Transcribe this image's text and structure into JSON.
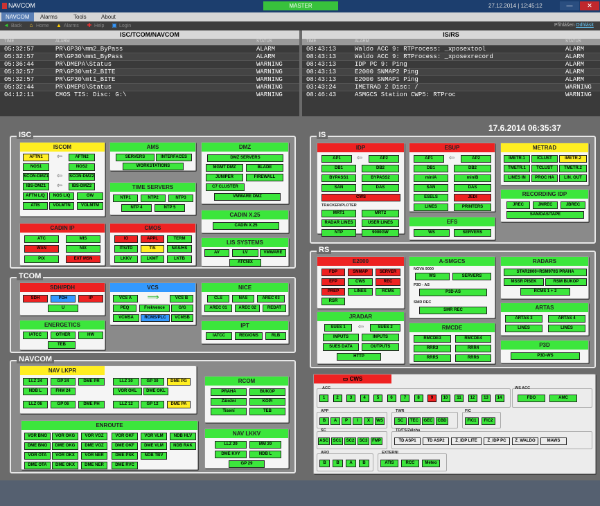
{
  "window": {
    "app_title": "NAVCOM",
    "master": "MASTER",
    "clock": "27.12.2014 | 12:45:12",
    "min_label": "—",
    "close_label": "✕"
  },
  "menu": [
    "NAVCOM",
    "Alarms",
    "Tools",
    "About"
  ],
  "toolbar": {
    "back": "Back",
    "home": "Home",
    "alarms": "Alarms",
    "help": "Help",
    "login": "Login",
    "user": "Přihlášen",
    "logout": "Odhlásit"
  },
  "alarm_left": {
    "title": "ISC/TCOM/NAVCOM",
    "col_time": "TIME",
    "col_alarm": "ALARM",
    "col_status": "STATUS",
    "rows": [
      {
        "time": "05:32:57",
        "alarm": "PR\\GP30\\mm2_ByPass",
        "status": "ALARM"
      },
      {
        "time": "05:32:57",
        "alarm": "PR\\GP30\\mm1_ByPass",
        "status": "ALARM"
      },
      {
        "time": "05:36:44",
        "alarm": "PR\\DMEPA\\Status",
        "status": "WARNING"
      },
      {
        "time": "05:32:57",
        "alarm": "PR\\GP30\\mt2_BITE",
        "status": "WARNING"
      },
      {
        "time": "05:32:57",
        "alarm": "PR\\GP30\\mt1_BITE",
        "status": "WARNING"
      },
      {
        "time": "05:32:44",
        "alarm": "PR\\DMEPG\\Status",
        "status": "WARNING"
      },
      {
        "time": "04:12:11",
        "alarm": "CMOS TIS: Disc: G:\\",
        "status": "WARNING"
      }
    ]
  },
  "alarm_right": {
    "title": "IS/RS",
    "col_time": "TIME",
    "col_alarm": "ALARM",
    "col_status": "STATUS",
    "rows": [
      {
        "time": "08:43:13",
        "alarm": "Waldo ACC 9: RTProcess: _xposextool",
        "status": "ALARM"
      },
      {
        "time": "08:43:13",
        "alarm": "Waldo ACC 9: RTProcess: _xposexrecord",
        "status": "ALARM"
      },
      {
        "time": "08:43:13",
        "alarm": "IDP PC 9: Ping",
        "status": "ALARM"
      },
      {
        "time": "08:43:13",
        "alarm": "E2000 SNMAP2 Ping",
        "status": "ALARM"
      },
      {
        "time": "08:43:13",
        "alarm": "E2000 SNMAP1 Ping",
        "status": "ALARM"
      },
      {
        "time": "03:43:24",
        "alarm": "IMETRAD 2 Disc: /",
        "status": "WARNING"
      },
      {
        "time": "08:46:43",
        "alarm": "ASMGCS Station CWP5: RTProc",
        "status": "WARNING"
      }
    ]
  },
  "timestamp": "17.6.2014 06:35:37",
  "colors": {
    "green": "#3ce63c",
    "red": "#ee2222",
    "yellow": "#ffee22",
    "blue": "#3399ff"
  },
  "groups": {
    "isc": "ISC",
    "tcom": "TCOM",
    "navcom": "NAVCOM",
    "is": "IS",
    "rs": "RS"
  },
  "panels": [
    {
      "id": "iscom",
      "title": "ISCOM",
      "color": "y",
      "buttons": [
        [
          "AFTN1",
          "y"
        ],
        [
          "AFTN2",
          "g"
        ],
        [
          "NOS1",
          "g"
        ],
        [
          "NOS2",
          "g"
        ],
        [
          "SCON-DMZ1",
          "g"
        ],
        [
          "SCON-DMZ2",
          "g"
        ],
        [
          "IBS-DMZ1",
          "g"
        ],
        [
          "IBS-DMZ2",
          "g"
        ],
        [
          "AFTN L/Q",
          "g"
        ],
        [
          "NOS L/Q",
          "g"
        ],
        [
          "GW",
          "g"
        ],
        [
          "ATIS",
          "g"
        ],
        [
          "VOLMTN",
          "g"
        ],
        [
          "VOLMTM",
          "g"
        ]
      ]
    },
    {
      "id": "ams",
      "title": "AMS",
      "color": "g",
      "buttons": [
        [
          "SERVERS",
          "g"
        ],
        [
          "INTERFACES",
          "g"
        ],
        [
          "WORKSTATIONS",
          "g"
        ]
      ]
    },
    {
      "id": "timeservers",
      "title": "TIME SERVERS",
      "color": "g",
      "buttons": [
        [
          "NTP1",
          "g"
        ],
        [
          "NTP2",
          "g"
        ],
        [
          "NTP3",
          "g"
        ],
        [
          "NTP 4",
          "g"
        ],
        [
          "NTP 5",
          "g"
        ]
      ]
    },
    {
      "id": "dmz",
      "title": "DMZ",
      "color": "g",
      "buttons": [
        [
          "DMZ SERVERS",
          "g"
        ],
        [
          "MGMT DMZ",
          "g"
        ],
        [
          "BLADE",
          "g"
        ],
        [
          "JUNIPER",
          "g"
        ],
        [
          "FIREWALL",
          "g"
        ],
        [
          "C7 CLUSTER",
          "g"
        ],
        [
          "VMWARE DMZ",
          "g"
        ]
      ]
    },
    {
      "id": "cadinx25",
      "title": "CADIN X.25",
      "color": "g",
      "buttons": [
        [
          "CADIN X.25",
          "g"
        ]
      ]
    },
    {
      "id": "cadinip",
      "title": "CADIN IP",
      "color": "r",
      "buttons": [
        [
          "ATC",
          "g"
        ],
        [
          "MIS",
          "g"
        ],
        [
          "WAN",
          "r"
        ],
        [
          "NIX",
          "g"
        ],
        [
          "PIX",
          "g"
        ],
        [
          "EXT MSN",
          "r"
        ]
      ]
    },
    {
      "id": "cmos",
      "title": "CMOS",
      "color": "r",
      "buttons": [
        [
          "IO",
          "r"
        ],
        [
          "APPL",
          "r"
        ],
        [
          "TERM",
          "g"
        ],
        [
          "ITS/TD",
          "g"
        ],
        [
          "TIS",
          "y"
        ],
        [
          "NAS/HS",
          "g"
        ],
        [
          "LKKV",
          "g"
        ],
        [
          "LKMT",
          "g"
        ],
        [
          "LKTB",
          "g"
        ]
      ]
    },
    {
      "id": "lissystems",
      "title": "LIS SYSTEMS",
      "color": "g",
      "buttons": [
        [
          "AV",
          "g"
        ],
        [
          "LV",
          "g"
        ],
        [
          "VMWARE",
          "g"
        ],
        [
          "ATCNIX",
          "g"
        ]
      ]
    },
    {
      "id": "sdhpdh",
      "title": "SDH/PDH",
      "color": "r",
      "buttons": [
        [
          "SDH",
          "r"
        ],
        [
          "PDH",
          "b"
        ],
        [
          "IP",
          "r"
        ],
        [
          "U",
          "g"
        ]
      ]
    },
    {
      "id": "vcs",
      "title": "VCS",
      "color": "b",
      "buttons": [
        [
          "VCS A",
          "g"
        ],
        [
          "VCS B",
          "g"
        ],
        [
          "PEQ",
          "g"
        ],
        [
          "Frekvence",
          "g"
        ],
        [
          "G/G",
          "g"
        ],
        [
          "VCMSA",
          "g"
        ],
        [
          "RCMS/PLC",
          "b"
        ],
        [
          "VCMSB",
          "g"
        ]
      ]
    },
    {
      "id": "nice",
      "title": "NICE",
      "color": "g",
      "buttons": [
        [
          "CLS",
          "g"
        ],
        [
          "NAS",
          "g"
        ],
        [
          "AREC 03",
          "g"
        ],
        [
          "AREC 01",
          "g"
        ],
        [
          "AREC 02",
          "g"
        ],
        [
          "REDAT",
          "g"
        ]
      ]
    },
    {
      "id": "energetics",
      "title": "ENERGETICS",
      "color": "g",
      "buttons": [
        [
          "IATCC",
          "g"
        ],
        [
          "OTHER",
          "g"
        ],
        [
          "HW",
          "g"
        ],
        [
          "TEB",
          "g"
        ]
      ]
    },
    {
      "id": "ipt",
      "title": "IPT",
      "color": "g",
      "buttons": [
        [
          "IATCC",
          "g"
        ],
        [
          "REGIONS",
          "g"
        ],
        [
          "RLB",
          "g"
        ]
      ]
    },
    {
      "id": "navlkpr",
      "title": "NAV LKPR",
      "color": "y",
      "buttons": [
        [
          "LLZ 24",
          "g"
        ],
        [
          "GP 24",
          "g"
        ],
        [
          "DME PR",
          "g"
        ],
        [
          "NDB L",
          "g"
        ],
        [
          "FHM 24",
          "g"
        ],
        [
          "LLZ 06",
          "g"
        ],
        [
          "GP 06",
          "g"
        ],
        [
          "DME PH",
          "g"
        ],
        [
          "LLZ 30",
          "g"
        ],
        [
          "GP 30",
          "g"
        ],
        [
          "DME PG",
          "y"
        ],
        [
          "VOR OKL",
          "g"
        ],
        [
          "DME OKL",
          "g"
        ],
        [
          "LLZ 12",
          "g"
        ],
        [
          "GP 12",
          "g"
        ],
        [
          "DME PA",
          "y"
        ]
      ]
    },
    {
      "id": "rcom",
      "title": "RCOM",
      "color": "g",
      "buttons": [
        [
          "PRAHA",
          "g"
        ],
        [
          "BUKOP",
          "g"
        ],
        [
          "Záložní",
          "g"
        ],
        [
          "KOPI",
          "g"
        ],
        [
          "Tisení",
          "g"
        ],
        [
          "TEB",
          "g"
        ]
      ]
    },
    {
      "id": "enroute",
      "title": "ENROUTE",
      "color": "g",
      "buttons": [
        [
          "VOR BNO",
          "g"
        ],
        [
          "VOR OKG",
          "g"
        ],
        [
          "VOR VOZ",
          "g"
        ],
        [
          "VOR OKF",
          "g"
        ],
        [
          "VOR VLM",
          "g"
        ],
        [
          "NDB HLV",
          "g"
        ],
        [
          "DME BNO",
          "g"
        ],
        [
          "DME OKG",
          "g"
        ],
        [
          "DME VOZ",
          "g"
        ],
        [
          "DME OKF",
          "g"
        ],
        [
          "DME VLM",
          "g"
        ],
        [
          "NDB RAK",
          "g"
        ],
        [
          "VOR OTA",
          "g"
        ],
        [
          "VOR OKX",
          "g"
        ],
        [
          "VOR NER",
          "g"
        ],
        [
          "DME PSK",
          "g"
        ],
        [
          "NDB TBV",
          "g"
        ],
        [
          "DME OTA",
          "g"
        ],
        [
          "DME OKX",
          "g"
        ],
        [
          "DME NER",
          "g"
        ],
        [
          "DME RVC",
          "g"
        ]
      ]
    },
    {
      "id": "navlkkv",
      "title": "NAV LKKV",
      "color": "g",
      "buttons": [
        [
          "LLZ 29",
          "g"
        ],
        [
          "MM 29",
          "g"
        ],
        [
          "DME KVY",
          "g"
        ],
        [
          "NDB L",
          "g"
        ],
        [
          "GP 29",
          "g"
        ]
      ]
    },
    {
      "id": "idp",
      "title": "IDP",
      "color": "r",
      "buttons": [
        [
          "AP1",
          "g"
        ],
        [
          "AP2",
          "g"
        ],
        [
          "DB1",
          "g"
        ],
        [
          "DB2",
          "g"
        ],
        [
          "BYPASS1",
          "g"
        ],
        [
          "BYPASS2",
          "g"
        ],
        [
          "SAN",
          "g"
        ],
        [
          "DAS",
          "g"
        ],
        [
          "CWS",
          "r"
        ],
        [
          "MRT1",
          "g"
        ],
        [
          "MRT2",
          "g"
        ],
        [
          "RADAR LINES",
          "g"
        ],
        [
          "USER LINES",
          "g"
        ],
        [
          "NTP",
          "g"
        ],
        [
          "9000GW",
          "g"
        ]
      ],
      "caption": "TRACKER/PLOTER"
    },
    {
      "id": "esup",
      "title": "ESUP",
      "color": "r",
      "buttons": [
        [
          "AP1",
          "g"
        ],
        [
          "AP2",
          "g"
        ],
        [
          "DB1",
          "g"
        ],
        [
          "DB2",
          "g"
        ],
        [
          "miniA",
          "g"
        ],
        [
          "miniB",
          "g"
        ],
        [
          "SAN",
          "g"
        ],
        [
          "DAS",
          "g"
        ],
        [
          "ESELS",
          "g"
        ],
        [
          "JEDI",
          "r"
        ],
        [
          "LINES",
          "g"
        ],
        [
          "PRINTERS",
          "g"
        ]
      ]
    },
    {
      "id": "metrad",
      "title": "METRAD",
      "color": "y",
      "buttons": [
        [
          "IMETR.1",
          "g"
        ],
        [
          "ICLUST",
          "g"
        ],
        [
          "IMETR.2",
          "y"
        ],
        [
          "TMETR.1",
          "g"
        ],
        [
          "TCLUST",
          "g"
        ],
        [
          "TMETR.2",
          "g"
        ],
        [
          "LINES IN",
          "g"
        ],
        [
          "PROC HA",
          "g"
        ],
        [
          "LIN. OUT",
          "g"
        ]
      ]
    },
    {
      "id": "recidp",
      "title": "RECORDING IDP",
      "color": "g",
      "buttons": [
        [
          "JREC",
          "g"
        ],
        [
          "JMREC",
          "g"
        ],
        [
          "JBREC",
          "g"
        ],
        [
          "SAN/DAS/TAPE",
          "g"
        ]
      ]
    },
    {
      "id": "efs",
      "title": "EFS",
      "color": "g",
      "buttons": [
        [
          "WS",
          "g"
        ],
        [
          "SERVERS",
          "g"
        ]
      ]
    },
    {
      "id": "e2000",
      "title": "E2000",
      "color": "r",
      "buttons": [
        [
          "FDP",
          "r"
        ],
        [
          "SNMAP",
          "r"
        ],
        [
          "SERVER",
          "r"
        ],
        [
          "EFP",
          "r"
        ],
        [
          "CWS",
          "g"
        ],
        [
          "REC",
          "r"
        ],
        [
          "PREP",
          "r"
        ],
        [
          "LINES",
          "g"
        ],
        [
          "RCMS",
          "g"
        ],
        [
          "RSR",
          "g"
        ]
      ]
    },
    {
      "id": "asmgcs",
      "title": "A-SMGCS",
      "color": "g",
      "buttons": [
        [
          "WS",
          "g"
        ],
        [
          "SERVERS",
          "g"
        ],
        [
          "P3D-AS",
          "g"
        ],
        [
          "SMR REC",
          "g"
        ]
      ],
      "captions": [
        "NOVA 9000",
        "P3D - AS",
        "SMR REC"
      ]
    },
    {
      "id": "radars",
      "title": "RADARS",
      "color": "g",
      "buttons": [
        [
          "STAR2000+RSM970S PRAHA",
          "g"
        ],
        [
          "MSSR PISEK",
          "g"
        ],
        [
          "RSM BUKOP",
          "g"
        ],
        [
          "RCMS 1 + 2",
          "g"
        ]
      ]
    },
    {
      "id": "jradar",
      "title": "JRADAR",
      "color": "g",
      "buttons": [
        [
          "SUES 1",
          "g"
        ],
        [
          "SUES 2",
          "g"
        ],
        [
          "INPUTS",
          "g"
        ],
        [
          "INPUTS",
          "g"
        ],
        [
          "SUES DATA",
          "g"
        ],
        [
          "OUTPUTS",
          "g"
        ],
        [
          "HTTP",
          "g"
        ]
      ]
    },
    {
      "id": "rmcde",
      "title": "RMCDE",
      "color": "g",
      "buttons": [
        [
          "RMCDE3",
          "g"
        ],
        [
          "RMCDE4",
          "g"
        ],
        [
          "RRR3",
          "g"
        ],
        [
          "RRR4",
          "g"
        ],
        [
          "RRR5",
          "g"
        ],
        [
          "RRR6",
          "g"
        ]
      ]
    },
    {
      "id": "artas",
      "title": "ARTAS",
      "color": "g",
      "buttons": [
        [
          "ARTAS 3",
          "g"
        ],
        [
          "ARTAS 4",
          "g"
        ],
        [
          "LINES",
          "g"
        ],
        [
          "LINES",
          "g"
        ]
      ]
    },
    {
      "id": "p3d",
      "title": "P3D",
      "color": "g",
      "buttons": [
        [
          "P3D-WS",
          "g"
        ]
      ]
    }
  ],
  "cws": {
    "title": "CWS",
    "acc_label": "ACC",
    "acc": [
      [
        "1",
        "g"
      ],
      [
        "2",
        "g"
      ],
      [
        "3",
        "g"
      ],
      [
        "4",
        "g"
      ],
      [
        "5",
        "g"
      ],
      [
        "6",
        "g"
      ],
      [
        "7",
        "g"
      ],
      [
        "8",
        "g"
      ],
      [
        "9",
        "r"
      ],
      [
        "10",
        "g"
      ],
      [
        "11",
        "g"
      ],
      [
        "12",
        "g"
      ],
      [
        "13",
        "g"
      ],
      [
        "14",
        "g"
      ]
    ],
    "wsacc_label": "WS ACC",
    "wsacc": [
      "FDO",
      "AMC"
    ],
    "app_label": "APP",
    "app": [
      "B",
      "A",
      "P",
      "I",
      "X",
      "WS"
    ],
    "twr_label": "TWR",
    "twr": [
      "SC",
      "TEC",
      "GEC",
      "CBD"
    ],
    "fic_label": "FIC",
    "fic": [
      "FIC1",
      "FIC2"
    ],
    "sc_label": "SC",
    "sc": [
      "ASC",
      "SC1",
      "SC2",
      "SC3",
      "FMP"
    ],
    "tdts_label": "TD/TS/Záloha",
    "tdts": [
      "TD ASP1",
      "TD ASP2",
      "Z_IDP LITE",
      "Z_IDP PC",
      "Z_WALDO",
      "MAWS"
    ],
    "aro_label": "ARO",
    "aro": [
      "B",
      "B",
      "A",
      "B"
    ],
    "ext_label": "EXTERNI",
    "ext": [
      "ATIS",
      "RCC",
      "Meteo"
    ]
  }
}
